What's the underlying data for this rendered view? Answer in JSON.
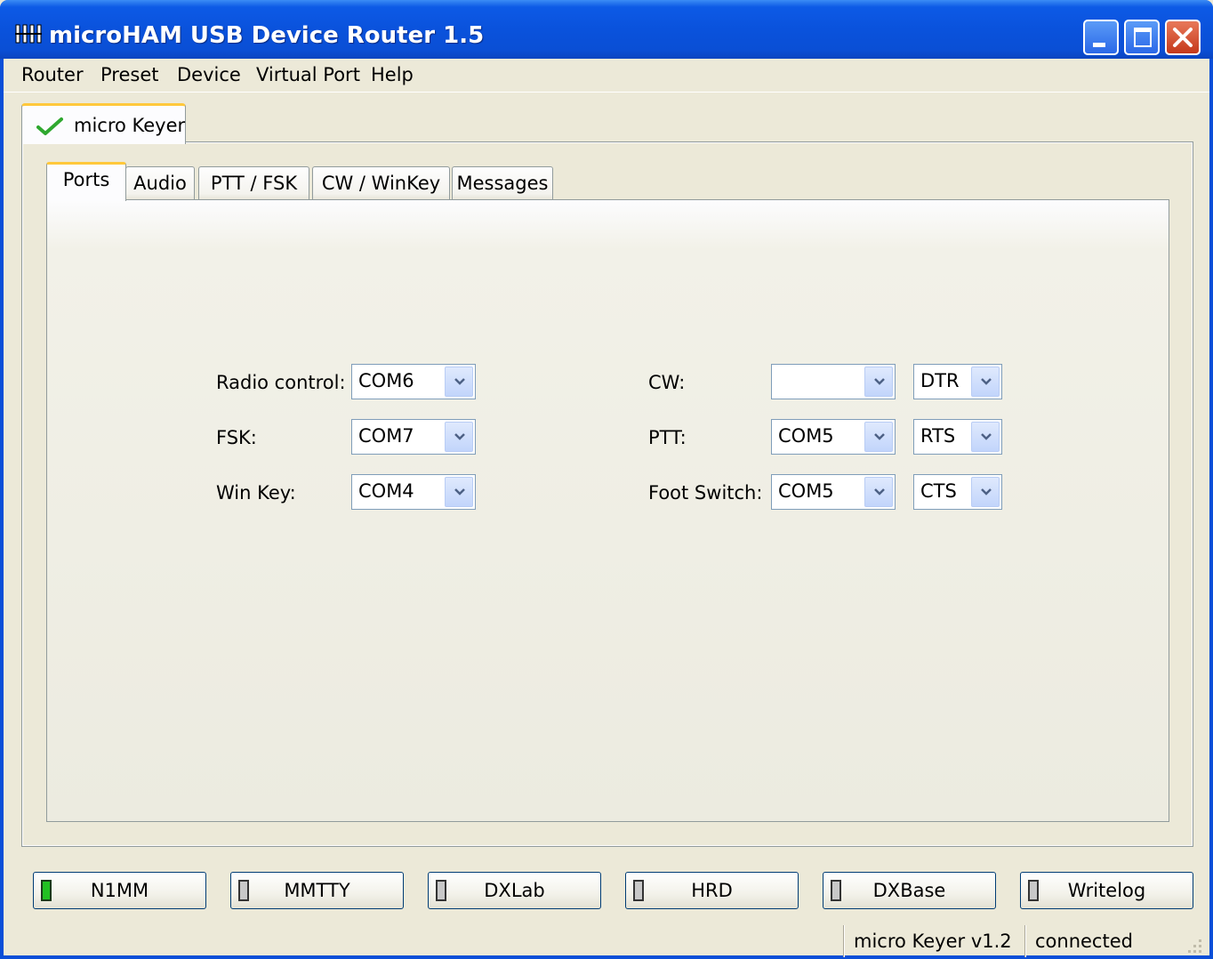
{
  "window": {
    "title": "microHAM USB Device Router 1.5",
    "app_icon": "router-icon",
    "title_buttons": [
      "minimize-icon",
      "maximize-icon",
      "close-icon"
    ]
  },
  "menu": [
    "Router",
    "Preset",
    "Device",
    "Virtual Port",
    "Help"
  ],
  "device_tab": {
    "label": "micro Keyer",
    "icon": "green-check-icon"
  },
  "tabs": [
    "Ports",
    "Audio",
    "PTT / FSK",
    "CW / WinKey",
    "Messages"
  ],
  "active_tab": "Ports",
  "ports": {
    "radio_control": {
      "label": "Radio control:",
      "value": "COM6"
    },
    "fsk": {
      "label": "FSK:",
      "value": "COM7"
    },
    "win_key": {
      "label": "Win Key:",
      "value": "COM4"
    },
    "cw": {
      "label": "CW:",
      "port": "",
      "line": "DTR"
    },
    "ptt": {
      "label": "PTT:",
      "port": "COM5",
      "line": "RTS"
    },
    "foot_switch": {
      "label": "Foot Switch:",
      "port": "COM5",
      "line": "CTS"
    }
  },
  "apps": [
    {
      "label": "N1MM",
      "active": true
    },
    {
      "label": "MMTTY",
      "active": false
    },
    {
      "label": "DXLab",
      "active": false
    },
    {
      "label": "HRD",
      "active": false
    },
    {
      "label": "DXBase",
      "active": false
    },
    {
      "label": "Writelog",
      "active": false
    }
  ],
  "status": {
    "device": "micro Keyer v1.2",
    "state": "connected"
  },
  "colors": {
    "title_blue": "#0a52dc",
    "tab_highlight": "#ffc83c",
    "led_on": "#22c022",
    "face": "#ece9d8"
  }
}
